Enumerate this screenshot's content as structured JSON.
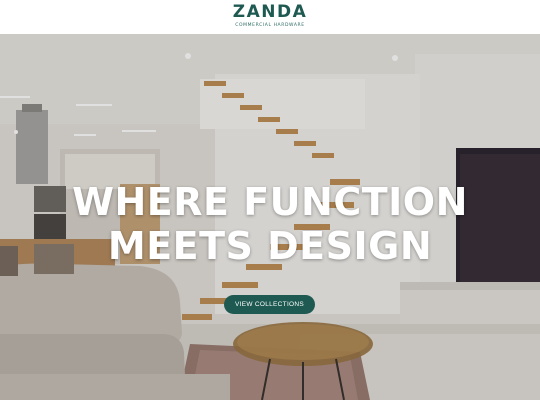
{
  "header": {
    "brand_name": "ZANDA",
    "brand_tagline": "COMMERCIAL HARDWARE"
  },
  "hero": {
    "title_line1": "WHERE FUNCTION",
    "title_line2": "MEETS DESIGN",
    "cta_label": "VIEW COLLECTIONS"
  },
  "colors": {
    "brand": "#1f5a52",
    "header_bg": "#ffffff",
    "hero_text": "#ffffff"
  }
}
